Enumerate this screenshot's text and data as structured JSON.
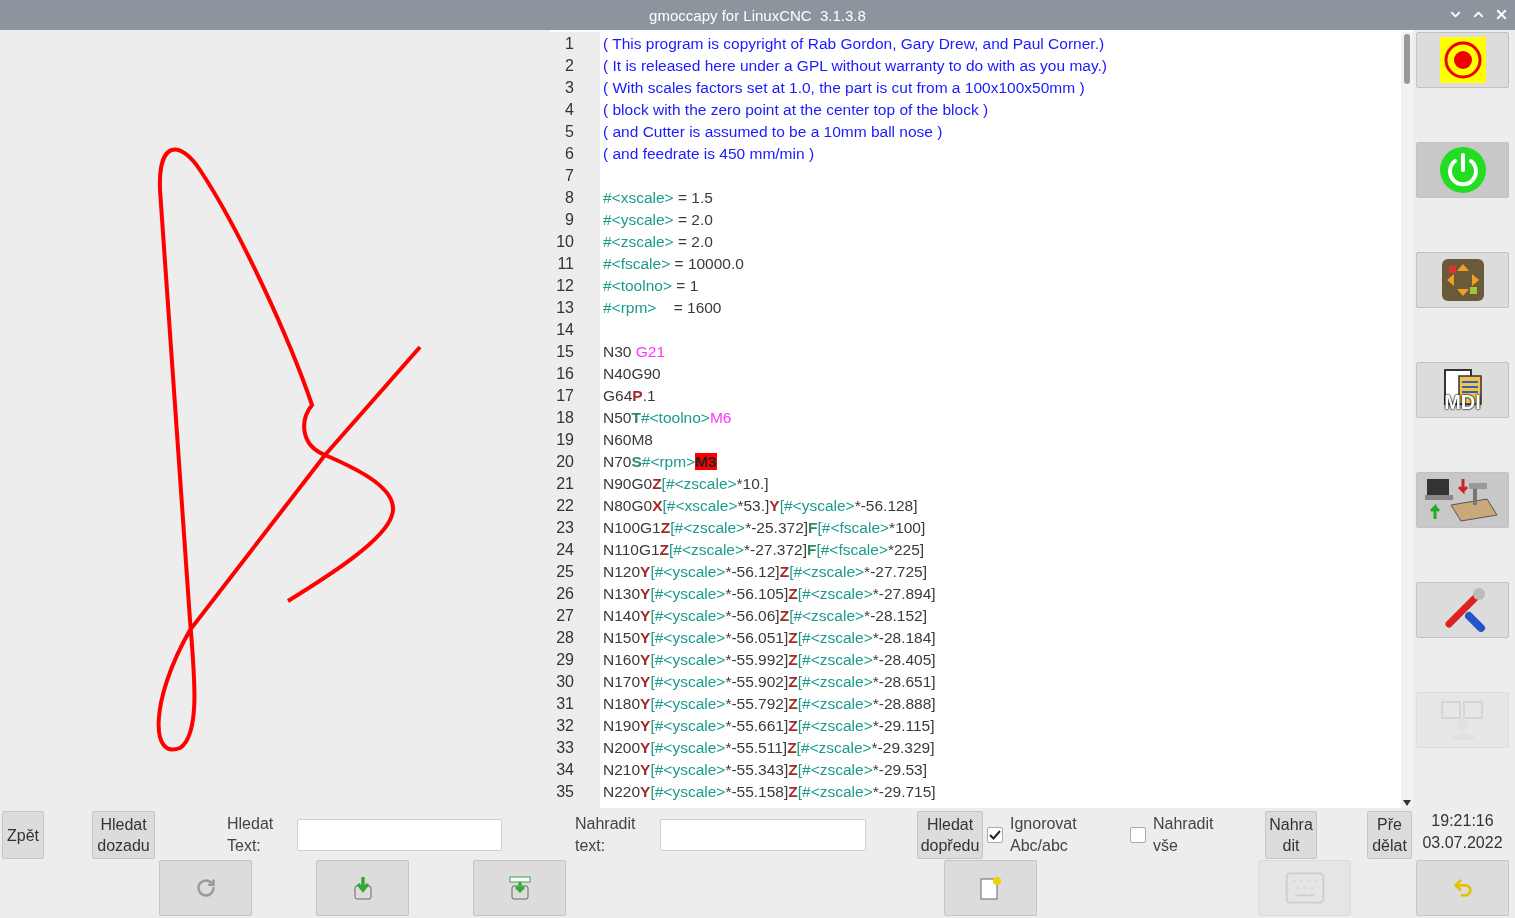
{
  "window": {
    "title": "gmoccapy for LinuxCNC  3.1.3.8"
  },
  "editor": {
    "lines": [
      {
        "number": "1",
        "segments": [
          {
            "t": "( This program is copyright of Rab Gordon, Gary Drew, and Paul Corner.)",
            "kind": "comment"
          }
        ]
      },
      {
        "number": "2",
        "segments": [
          {
            "t": "( It is released here under a GPL without warranty to do with as you may.)",
            "kind": "comment"
          }
        ]
      },
      {
        "number": "3",
        "segments": [
          {
            "t": "( With scales factors set at 1.0, the part is cut from a 100x100x50mm )",
            "kind": "comment"
          }
        ]
      },
      {
        "number": "4",
        "segments": [
          {
            "t": "( block with the zero point at the center top of the block )",
            "kind": "comment"
          }
        ]
      },
      {
        "number": "5",
        "segments": [
          {
            "t": "( and Cutter is assumed to be a 10mm ball nose )",
            "kind": "comment"
          }
        ]
      },
      {
        "number": "6",
        "segments": [
          {
            "t": "( and feedrate is 450 mm/min )",
            "kind": "comment"
          }
        ]
      },
      {
        "number": "7"
      },
      {
        "number": "8",
        "segments": [
          {
            "t": "#<xscale>",
            "kind": "param"
          },
          {
            "t": " = 1.5",
            "kind": "plain"
          }
        ]
      },
      {
        "number": "9",
        "segments": [
          {
            "t": "#<yscale>",
            "kind": "param"
          },
          {
            "t": " = 2.0",
            "kind": "plain"
          }
        ]
      },
      {
        "number": "10",
        "segments": [
          {
            "t": "#<zscale>",
            "kind": "param"
          },
          {
            "t": " = 2.0",
            "kind": "plain"
          }
        ]
      },
      {
        "number": "11",
        "segments": [
          {
            "t": "#<fscale>",
            "kind": "param"
          },
          {
            "t": " = 10000.0",
            "kind": "plain"
          }
        ]
      },
      {
        "number": "12",
        "segments": [
          {
            "t": "#<toolno>",
            "kind": "param"
          },
          {
            "t": " = 1",
            "kind": "plain"
          }
        ]
      },
      {
        "number": "13",
        "segments": [
          {
            "t": "#<rpm>",
            "kind": "param"
          },
          {
            "t": "    = 1600",
            "kind": "plain"
          }
        ]
      },
      {
        "number": "14"
      },
      {
        "number": "15",
        "segments": [
          {
            "t": "N30 ",
            "kind": "plain"
          },
          {
            "t": "G21",
            "kind": "code"
          }
        ]
      },
      {
        "number": "16",
        "segments": [
          {
            "t": "N40G90",
            "kind": "plain"
          }
        ]
      },
      {
        "number": "17",
        "segments": [
          {
            "t": "G64",
            "kind": "plain"
          },
          {
            "t": "P",
            "kind": "axis"
          },
          {
            "t": ".1",
            "kind": "plain"
          }
        ]
      },
      {
        "number": "18",
        "segments": [
          {
            "t": "N50",
            "kind": "plain"
          },
          {
            "t": "T",
            "kind": "word"
          },
          {
            "t": "#<toolno>",
            "kind": "param"
          },
          {
            "t": "M6",
            "kind": "code"
          }
        ]
      },
      {
        "number": "19",
        "segments": [
          {
            "t": "N60M8",
            "kind": "plain"
          }
        ]
      },
      {
        "number": "20",
        "segments": [
          {
            "t": "N70",
            "kind": "plain"
          },
          {
            "t": "S",
            "kind": "word"
          },
          {
            "t": "#<rpm>",
            "kind": "param"
          },
          {
            "t": "M3",
            "kind": "error"
          }
        ]
      },
      {
        "number": "21",
        "segments": [
          {
            "t": "N90G0",
            "kind": "plain"
          },
          {
            "t": "Z",
            "kind": "axis"
          },
          {
            "t": "[#<zscale>",
            "kind": "param"
          },
          {
            "t": "*10.]",
            "kind": "plain"
          }
        ]
      },
      {
        "number": "22",
        "segments": [
          {
            "t": "N80G0",
            "kind": "plain"
          },
          {
            "t": "X",
            "kind": "axis"
          },
          {
            "t": "[#<xscale>",
            "kind": "param"
          },
          {
            "t": "*53.]",
            "kind": "plain"
          },
          {
            "t": "Y",
            "kind": "axis"
          },
          {
            "t": "[#<yscale>",
            "kind": "param"
          },
          {
            "t": "*-56.128]",
            "kind": "plain"
          }
        ]
      },
      {
        "number": "23",
        "segments": [
          {
            "t": "N100G1",
            "kind": "plain"
          },
          {
            "t": "Z",
            "kind": "axis"
          },
          {
            "t": "[#<zscale>",
            "kind": "param"
          },
          {
            "t": "*-25.372]",
            "kind": "plain"
          },
          {
            "t": "F",
            "kind": "word"
          },
          {
            "t": "[#<fscale>",
            "kind": "param"
          },
          {
            "t": "*100]",
            "kind": "plain"
          }
        ]
      },
      {
        "number": "24",
        "segments": [
          {
            "t": "N110G1",
            "kind": "plain"
          },
          {
            "t": "Z",
            "kind": "axis"
          },
          {
            "t": "[#<zscale>",
            "kind": "param"
          },
          {
            "t": "*-27.372]",
            "kind": "plain"
          },
          {
            "t": "F",
            "kind": "word"
          },
          {
            "t": "[#<fscale>",
            "kind": "param"
          },
          {
            "t": "*225]",
            "kind": "plain"
          }
        ]
      },
      {
        "number": "25",
        "segments": [
          {
            "t": "N120",
            "kind": "plain"
          },
          {
            "t": "Y",
            "kind": "axis"
          },
          {
            "t": "[#<yscale>",
            "kind": "param"
          },
          {
            "t": "*-56.12]",
            "kind": "plain"
          },
          {
            "t": "Z",
            "kind": "axis"
          },
          {
            "t": "[#<zscale>",
            "kind": "param"
          },
          {
            "t": "*-27.725]",
            "kind": "plain"
          }
        ]
      },
      {
        "number": "26",
        "segments": [
          {
            "t": "N130",
            "kind": "plain"
          },
          {
            "t": "Y",
            "kind": "axis"
          },
          {
            "t": "[#<yscale>",
            "kind": "param"
          },
          {
            "t": "*-56.105]",
            "kind": "plain"
          },
          {
            "t": "Z",
            "kind": "axis"
          },
          {
            "t": "[#<zscale>",
            "kind": "param"
          },
          {
            "t": "*-27.894]",
            "kind": "plain"
          }
        ]
      },
      {
        "number": "27",
        "segments": [
          {
            "t": "N140",
            "kind": "plain"
          },
          {
            "t": "Y",
            "kind": "axis"
          },
          {
            "t": "[#<yscale>",
            "kind": "param"
          },
          {
            "t": "*-56.06]",
            "kind": "plain"
          },
          {
            "t": "Z",
            "kind": "axis"
          },
          {
            "t": "[#<zscale>",
            "kind": "param"
          },
          {
            "t": "*-28.152]",
            "kind": "plain"
          }
        ]
      },
      {
        "number": "28",
        "segments": [
          {
            "t": "N150",
            "kind": "plain"
          },
          {
            "t": "Y",
            "kind": "axis"
          },
          {
            "t": "[#<yscale>",
            "kind": "param"
          },
          {
            "t": "*-56.051]",
            "kind": "plain"
          },
          {
            "t": "Z",
            "kind": "axis"
          },
          {
            "t": "[#<zscale>",
            "kind": "param"
          },
          {
            "t": "*-28.184]",
            "kind": "plain"
          }
        ]
      },
      {
        "number": "29",
        "segments": [
          {
            "t": "N160",
            "kind": "plain"
          },
          {
            "t": "Y",
            "kind": "axis"
          },
          {
            "t": "[#<yscale>",
            "kind": "param"
          },
          {
            "t": "*-55.992]",
            "kind": "plain"
          },
          {
            "t": "Z",
            "kind": "axis"
          },
          {
            "t": "[#<zscale>",
            "kind": "param"
          },
          {
            "t": "*-28.405]",
            "kind": "plain"
          }
        ]
      },
      {
        "number": "30",
        "segments": [
          {
            "t": "N170",
            "kind": "plain"
          },
          {
            "t": "Y",
            "kind": "axis"
          },
          {
            "t": "[#<yscale>",
            "kind": "param"
          },
          {
            "t": "*-55.902]",
            "kind": "plain"
          },
          {
            "t": "Z",
            "kind": "axis"
          },
          {
            "t": "[#<zscale>",
            "kind": "param"
          },
          {
            "t": "*-28.651]",
            "kind": "plain"
          }
        ]
      },
      {
        "number": "31",
        "segments": [
          {
            "t": "N180",
            "kind": "plain"
          },
          {
            "t": "Y",
            "kind": "axis"
          },
          {
            "t": "[#<yscale>",
            "kind": "param"
          },
          {
            "t": "*-55.792]",
            "kind": "plain"
          },
          {
            "t": "Z",
            "kind": "axis"
          },
          {
            "t": "[#<zscale>",
            "kind": "param"
          },
          {
            "t": "*-28.888]",
            "kind": "plain"
          }
        ]
      },
      {
        "number": "32",
        "segments": [
          {
            "t": "N190",
            "kind": "plain"
          },
          {
            "t": "Y",
            "kind": "axis"
          },
          {
            "t": "[#<yscale>",
            "kind": "param"
          },
          {
            "t": "*-55.661]",
            "kind": "plain"
          },
          {
            "t": "Z",
            "kind": "axis"
          },
          {
            "t": "[#<zscale>",
            "kind": "param"
          },
          {
            "t": "*-29.115]",
            "kind": "plain"
          }
        ]
      },
      {
        "number": "33",
        "segments": [
          {
            "t": "N200",
            "kind": "plain"
          },
          {
            "t": "Y",
            "kind": "axis"
          },
          {
            "t": "[#<yscale>",
            "kind": "param"
          },
          {
            "t": "*-55.511]",
            "kind": "plain"
          },
          {
            "t": "Z",
            "kind": "axis"
          },
          {
            "t": "[#<zscale>",
            "kind": "param"
          },
          {
            "t": "*-29.329]",
            "kind": "plain"
          }
        ]
      },
      {
        "number": "34",
        "segments": [
          {
            "t": "N210",
            "kind": "plain"
          },
          {
            "t": "Y",
            "kind": "axis"
          },
          {
            "t": "[#<yscale>",
            "kind": "param"
          },
          {
            "t": "*-55.343]",
            "kind": "plain"
          },
          {
            "t": "Z",
            "kind": "axis"
          },
          {
            "t": "[#<zscale>",
            "kind": "param"
          },
          {
            "t": "*-29.53]",
            "kind": "plain"
          }
        ]
      },
      {
        "number": "35",
        "segments": [
          {
            "t": "N220",
            "kind": "plain"
          },
          {
            "t": "Y",
            "kind": "axis"
          },
          {
            "t": "[#<yscale>",
            "kind": "param"
          },
          {
            "t": "*-55.158]",
            "kind": "plain"
          },
          {
            "t": "Z",
            "kind": "axis"
          },
          {
            "t": "[#<zscale>",
            "kind": "param"
          },
          {
            "t": "*-29.715]",
            "kind": "plain"
          }
        ]
      }
    ]
  },
  "search_bar": {
    "back_button": "Zpět",
    "search_back_button": "Hledat\ndozadu",
    "search_label": "Hledat\nText:",
    "replace_label": "Nahradit\ntext:",
    "search_forward_button": "Hledat\ndopředu",
    "checkboxes": [
      {
        "label": "Ignorovat\nAbc/abc",
        "checked": true
      },
      {
        "label": "Nahradit\nvše",
        "checked": false
      }
    ],
    "replace_button": "Nahra\ndit",
    "redo_button": "Pře\ndělat"
  },
  "tool_buttons": [
    {
      "kind": "reload",
      "disabled": false
    },
    {
      "kind": "save",
      "disabled": false
    },
    {
      "kind": "save_as",
      "disabled": false
    },
    {
      "kind": "new",
      "disabled": false
    },
    {
      "kind": "keyboard",
      "disabled": true
    }
  ],
  "sidebar": {
    "buttons": [
      {
        "kind": "estop",
        "pressed": false,
        "disabled": false
      },
      {
        "kind": "power",
        "pressed": true,
        "disabled": false
      },
      {
        "kind": "jog",
        "pressed": false,
        "disabled": false
      },
      {
        "kind": "mdi",
        "label": "MDI",
        "pressed": false,
        "disabled": false
      },
      {
        "kind": "auto",
        "pressed": true,
        "disabled": false
      },
      {
        "kind": "settings",
        "pressed": false,
        "disabled": false
      },
      {
        "kind": "user",
        "pressed": false,
        "disabled": true
      }
    ]
  },
  "clock": {
    "time": "19:21:16",
    "date": "03.07.2022"
  },
  "undo_button": {
    "disabled": false
  }
}
